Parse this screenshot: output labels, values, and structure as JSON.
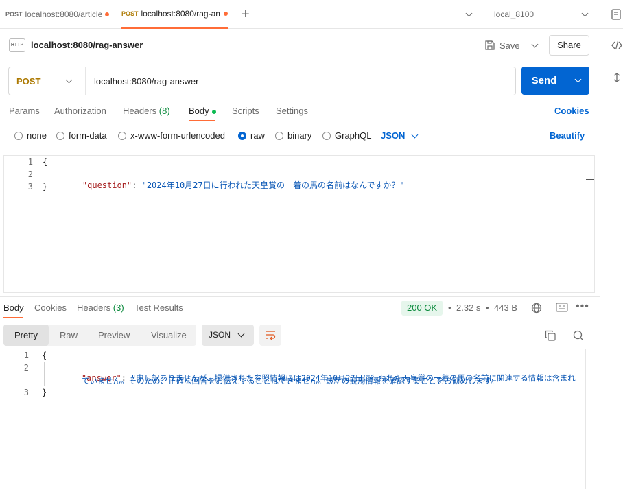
{
  "tabs": [
    {
      "method": "POST",
      "url": "localhost:8080/article"
    },
    {
      "method": "POST",
      "url": "localhost:8080/rag-an"
    }
  ],
  "environment": "local_8100",
  "request": {
    "name": "localhost:8080/rag-answer",
    "method": "POST",
    "url": "localhost:8080/rag-answer",
    "save_label": "Save",
    "share_label": "Share",
    "send_label": "Send"
  },
  "request_tabs": {
    "params": "Params",
    "authorization": "Authorization",
    "headers": "Headers",
    "headers_count": "(8)",
    "body": "Body",
    "scripts": "Scripts",
    "settings": "Settings",
    "cookies": "Cookies"
  },
  "body_types": {
    "none": "none",
    "form_data": "form-data",
    "urlencoded": "x-www-form-urlencoded",
    "raw": "raw",
    "binary": "binary",
    "graphql": "GraphQL",
    "format": "JSON",
    "beautify": "Beautify",
    "selected": "raw"
  },
  "request_body": {
    "line_numbers": [
      "1",
      "2",
      "3"
    ],
    "open": "{",
    "key": "\"question\"",
    "colon": ": ",
    "value": "\"2024年10月27日に行われた天皇賞の一着の馬の名前はなんですか？\"",
    "close": "}"
  },
  "response_tabs": {
    "body": "Body",
    "cookies": "Cookies",
    "headers": "Headers",
    "headers_count": "(3)",
    "test_results": "Test Results"
  },
  "response_meta": {
    "status": "200 OK",
    "time": "2.32 s",
    "size": "443 B"
  },
  "response_view": {
    "pretty": "Pretty",
    "raw": "Raw",
    "preview": "Preview",
    "visualize": "Visualize",
    "format": "JSON"
  },
  "response_body": {
    "line_numbers": [
      "1",
      "2",
      "3"
    ],
    "open": "{",
    "key": "\"answer\"",
    "colon": ": ",
    "value_line1": "\"申し訳ありませんが、提供された参照情報には2024年10月27日に行われた天皇賞の一着の馬の名前に関連する情報は含まれ",
    "value_line2": "ていません。そのため、正確な回答をお伝えすることはできません。最新の競馬情報を確認することをお勧めします。\"",
    "close": "}"
  },
  "colors": {
    "accent": "#ff6c37",
    "primary": "#0265d2",
    "post_method": "#ad7a03",
    "success": "#0a8a3c"
  }
}
